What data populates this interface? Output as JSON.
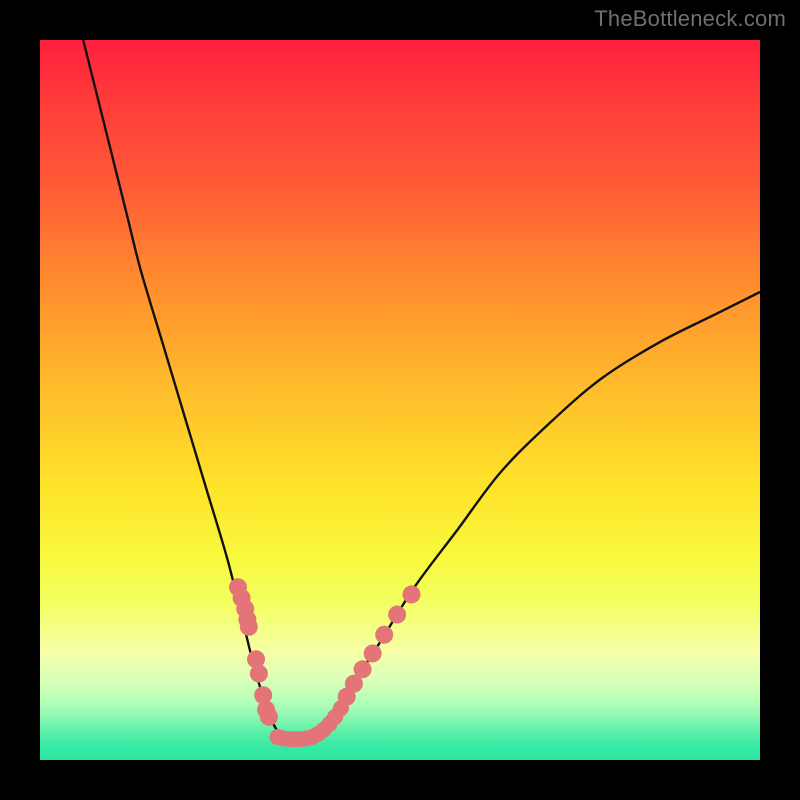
{
  "watermark": "TheBottleneck.com",
  "colors": {
    "curve_stroke": "#111111",
    "dot_fill": "#e37477",
    "band_colors": [
      "#ff1f3e",
      "#ff3a3a",
      "#ff5a36",
      "#ff8a2f",
      "#ffbb2b",
      "#ffe32a",
      "#f8f93e",
      "#f3ff60",
      "#f6ffa7",
      "#d9ffb8",
      "#b2ffb8",
      "#8cf7b1",
      "#5ef0aa",
      "#38eaa5",
      "#2be7a2"
    ]
  },
  "chart_data": {
    "type": "line",
    "title": "",
    "xlabel": "",
    "ylabel": "",
    "xlim": [
      0,
      100
    ],
    "ylim": [
      0,
      100
    ],
    "series": [
      {
        "name": "bottleneck-curve",
        "x": [
          6,
          8,
          10,
          12,
          14,
          17,
          20,
          23,
          26,
          28,
          30,
          32,
          33,
          34,
          35,
          36,
          38,
          40,
          43,
          47,
          52,
          58,
          64,
          71,
          78,
          86,
          94,
          100
        ],
        "y": [
          100,
          92,
          84,
          76,
          68,
          58,
          48,
          38,
          28,
          20,
          12,
          6,
          4,
          3,
          3,
          3,
          4,
          6,
          10,
          16,
          24,
          32,
          40,
          47,
          53,
          58,
          62,
          65
        ]
      }
    ],
    "dots": {
      "left_cluster_x": [
        27.5,
        28.0,
        28.5,
        28.8,
        29.0,
        30.0,
        30.4,
        31.0,
        31.4,
        31.8
      ],
      "left_cluster_y": [
        24.0,
        22.5,
        21.0,
        19.5,
        18.5,
        14.0,
        12.0,
        9.0,
        7.0,
        6.0
      ],
      "saddle_x": [
        33.0,
        33.8,
        34.6,
        35.4,
        36.2,
        37.0,
        37.8,
        38.6,
        39.4,
        40.2,
        41.0,
        41.8
      ],
      "saddle_y": [
        3.2,
        3.0,
        2.9,
        2.9,
        2.9,
        3.0,
        3.2,
        3.6,
        4.2,
        5.0,
        6.0,
        7.2
      ],
      "right_cluster_x": [
        42.6,
        43.6,
        44.8,
        46.2,
        47.8,
        49.6,
        51.6
      ],
      "right_cluster_y": [
        8.8,
        10.6,
        12.6,
        14.8,
        17.4,
        20.2,
        23.0
      ]
    }
  }
}
